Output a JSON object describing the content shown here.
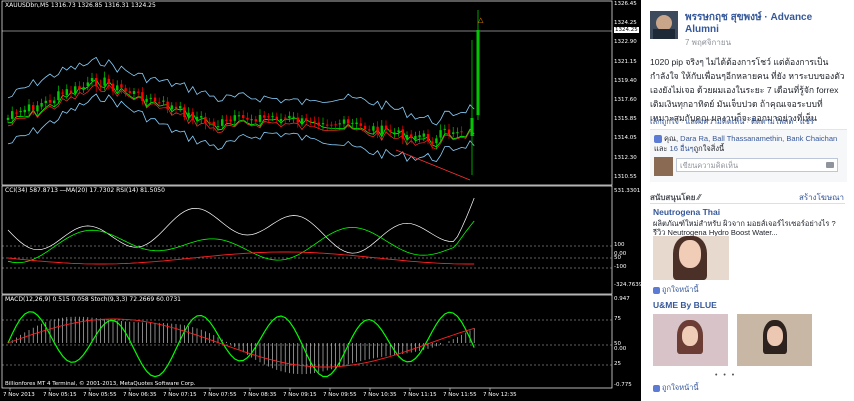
{
  "chart": {
    "main_title": "XAUUSDbn,M5  1316.73 1326.85 1316.31 1324.25",
    "cci_title": "CCI(34) 587.8713  ⎯⎯MA(20) 17.7302  RSI(14) 81.5050",
    "macd_title": "MACD(12,26,9) 0.515 0.058  Stoch(9,3,3) 72.2669 60.0731",
    "copyright": "Billionfores MT 4 Terminal, © 2001-2013, MetaQuotes Software Corp.",
    "main_price_labels": [
      "1326.45",
      "1324.25",
      "1322.90",
      "1321.15",
      "1319.40",
      "1317.60",
      "1315.85",
      "1314.05",
      "1312.30",
      "1310.55"
    ],
    "cci_labels": [
      "531.3301",
      "100",
      "50",
      "0.00",
      "-100",
      "-324.7639"
    ],
    "macd_labels": [
      "0.947",
      "75",
      "50",
      "25",
      "0.00",
      "-0.775"
    ],
    "time_labels": [
      "7 Nov 2013",
      "7 Nov 05:15",
      "7 Nov 05:55",
      "7 Nov 06:35",
      "7 Nov 07:15",
      "7 Nov 07:55",
      "7 Nov 08:35",
      "7 Nov 09:15",
      "7 Nov 09:55",
      "7 Nov 10:35",
      "7 Nov 11:15",
      "7 Nov 11:55",
      "7 Nov 12:35"
    ],
    "current_price": "1324.25",
    "colors": {
      "bull": "#00c800",
      "bear": "#ff0000",
      "band": "#87cefa",
      "ma_green": "#00ff00",
      "ma_red": "#ff3030",
      "cci_white": "#ffffff",
      "stoch_green": "#00ff00",
      "signal_red": "#ff2020"
    }
  },
  "post": {
    "author": "พรรษกฤช สุขพงษ์ · Advance Alumni",
    "time": "7 พฤศจิกายน",
    "text": "1020 pip จริงๆ ไม่ได้ต้องการโชว์ แต่ต้องการเป็นกำลังใจ ให้กับเพื่อนๆอีกหลายคน ที่ยัง หาระบบของตัวเองยังไม่เจอ ด้วยผมเองในระยะ 7 เดือนที่รู้จัก forrex เติมเงินทุกอาทิตย์ มันเจ็บปวด ถ้าคุณเจอระบบที่เหมาะสมกับคุณ ผลงานก็จะออกมาอย่างที่เห็น",
    "actions": [
      "เลิกถูกใจ",
      "แสดงความคิดเห็น",
      "ติดตามโพสต์",
      "แชร์"
    ],
    "likes_prefix": "คุณ, ",
    "likes_names": "Dara Ra, Ball Thassanamethin, Bank Chaichan",
    "likes_and": " และ ",
    "likes_others": "16 อื่นๆ",
    "likes_suffix": "ถูกใจสิ่งนี้",
    "comment_placeholder": "เขียนความคิดเห็น"
  },
  "sponsored": {
    "header": "สนับสนุนโดย",
    "create_ad": "สร้างโฆษณา",
    "ad1_title": "Neutrogena Thai",
    "ad1_text": "ผลิตภัณฑ์ใหม่สำหรับ ผิวจาก มอยส์เจอร์ไรเซอร์อย่างไร ? รีวิว Neutrogena Hydro Boost Water...",
    "ad1_like": "ถูกใจหน้านี้",
    "ad2_title": "U&ME By BLUE",
    "ad2_like": "ถูกใจหน้านี้",
    "carousel_dots": "• • •"
  }
}
